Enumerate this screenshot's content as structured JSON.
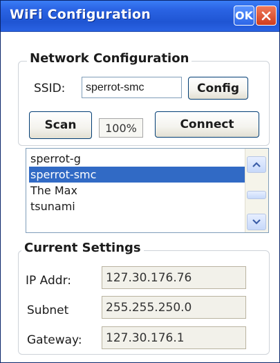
{
  "window": {
    "title": "WiFi Configuration",
    "ok_label": "OK"
  },
  "network": {
    "group_label": "Network Configuration",
    "ssid_label": "SSID:",
    "ssid_value": "sperrot-smc",
    "config_label": "Config",
    "scan_label": "Scan",
    "progress": "100%",
    "connect_label": "Connect"
  },
  "networks": {
    "items": [
      "sperrot-g",
      "sperrot-smc",
      "The Max",
      "tsunami"
    ],
    "selected": "sperrot-smc"
  },
  "current": {
    "group_label": "Current Settings",
    "ip_label": "IP Addr:",
    "ip_value": "127.30.176.76",
    "subnet_label": "Subnet",
    "subnet_value": "255.255.250.0",
    "gateway_label": "Gateway:",
    "gateway_value": "127.30.176.1"
  },
  "icons": {
    "ok": "ok-button",
    "close": "close-icon",
    "scroll_up": "chevron-up-icon",
    "scroll_down": "chevron-down-icon"
  },
  "colors": {
    "titlebar": "#2a63e3",
    "selection": "#316ac5",
    "close_button": "#cf3d1f"
  }
}
